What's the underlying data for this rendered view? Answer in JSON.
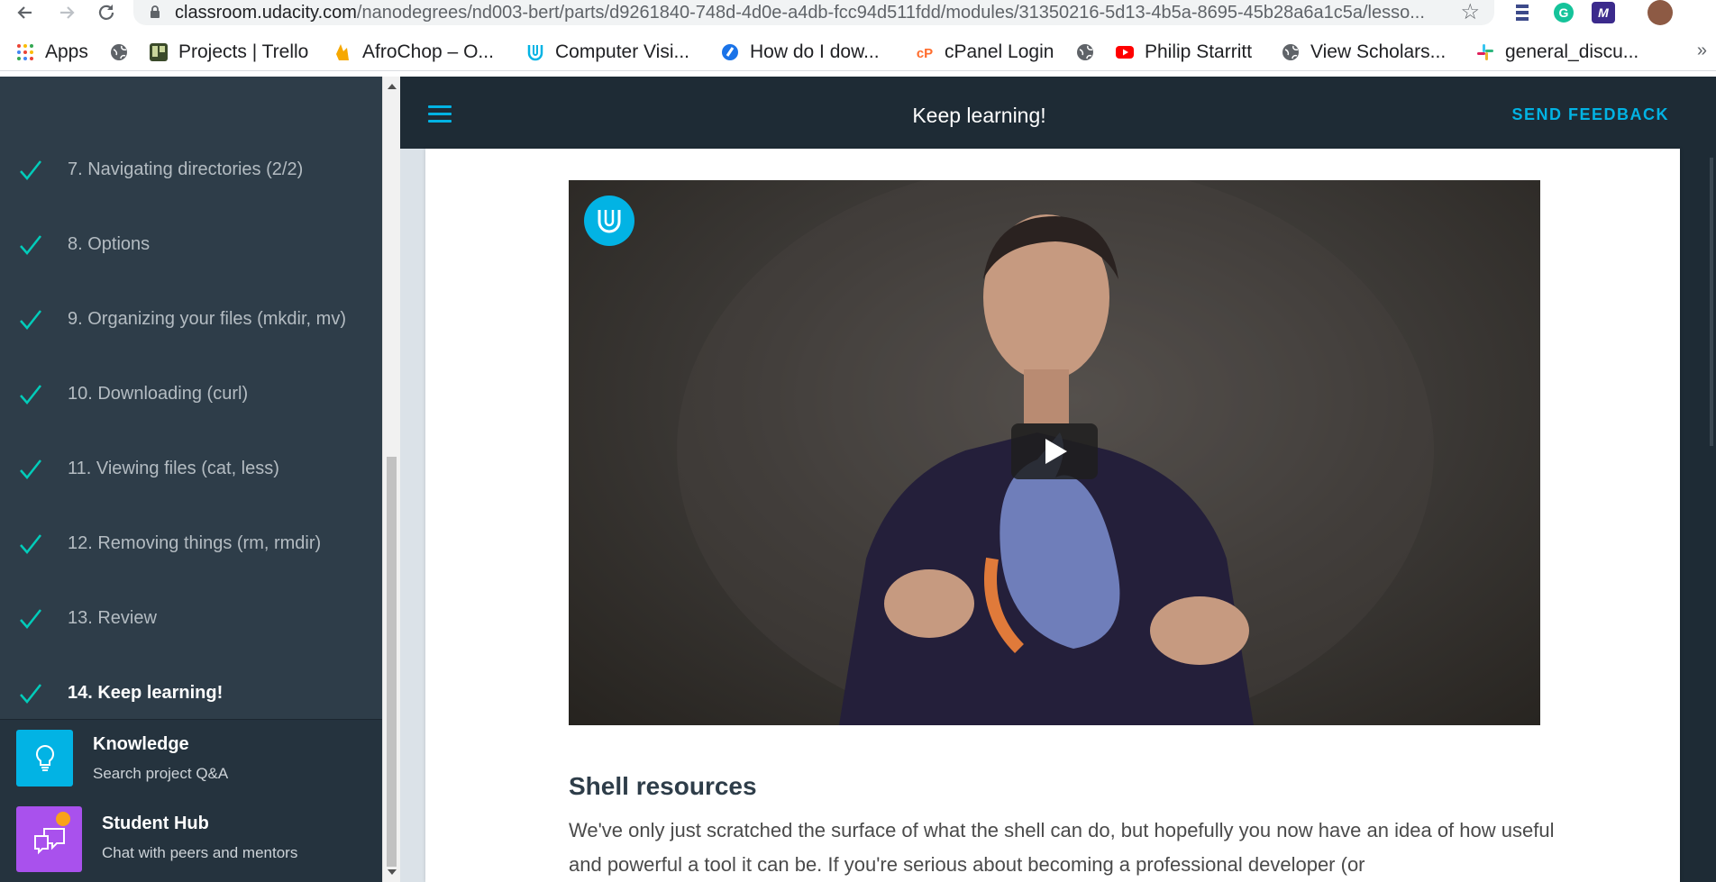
{
  "browser": {
    "url_host": "classroom.udacity.com",
    "url_path": "/nanodegrees/nd003-bert/parts/d9261840-748d-4d0e-a4db-fcc94d511fdd/modules/31350216-5d13-4b5a-8695-45b28a6a1c5a/lesso...",
    "bookmarks": [
      {
        "label": "Apps",
        "icon": "apps-grid-icon"
      },
      {
        "label": "",
        "icon": "globe-icon"
      },
      {
        "label": "Projects | Trello",
        "icon": "trello-icon"
      },
      {
        "label": "AfroChop – O...",
        "icon": "afrochop-icon"
      },
      {
        "label": "Computer Visi...",
        "icon": "udacity-icon"
      },
      {
        "label": "How do I dow...",
        "icon": "circle-d-icon"
      },
      {
        "label": "cPanel Login",
        "icon": "cpanel-icon"
      },
      {
        "label": "",
        "icon": "globe-icon"
      },
      {
        "label": "Philip Starritt",
        "icon": "youtube-icon"
      },
      {
        "label": "View Scholars...",
        "icon": "globe-icon"
      },
      {
        "label": "general_discu...",
        "icon": "slack-icon"
      }
    ],
    "more": "»"
  },
  "sidebar": {
    "lessons": [
      {
        "label": "7. Navigating directories (2/2)",
        "active": false
      },
      {
        "label": "8. Options",
        "active": false
      },
      {
        "label": "9. Organizing your files (mkdir, mv)",
        "active": false
      },
      {
        "label": "10. Downloading (curl)",
        "active": false
      },
      {
        "label": "11. Viewing files (cat, less)",
        "active": false
      },
      {
        "label": "12. Removing things (rm, rmdir)",
        "active": false
      },
      {
        "label": "13. Review",
        "active": false
      },
      {
        "label": "14. Keep learning!",
        "active": true
      }
    ],
    "knowledge": {
      "title": "Knowledge",
      "subtitle": "Search project Q&A"
    },
    "student_hub": {
      "title": "Student Hub",
      "subtitle": "Chat with peers and mentors"
    }
  },
  "topbar": {
    "title": "Keep learning!",
    "feedback": "SEND FEEDBACK"
  },
  "content": {
    "section_title": "Shell resources",
    "paragraph": "We've only just scratched the surface of what the shell can do, but hopefully you now have an idea of how useful and powerful a tool it can be. If you're serious about becoming a professional developer (or"
  },
  "colors": {
    "accent": "#02b3e4",
    "check": "#02ccba",
    "sidebar_bg": "#2e3d49",
    "topbar_bg": "#1e2b35",
    "hub_purple": "#a951ed",
    "notification": "#f9a21a"
  }
}
